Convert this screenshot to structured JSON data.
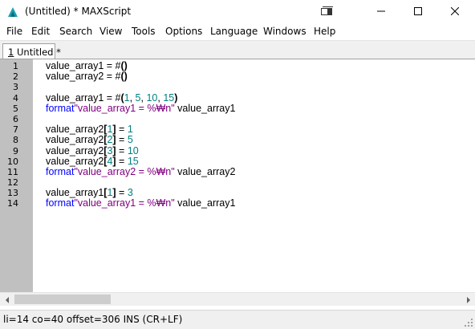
{
  "window": {
    "title": "(Untitled) * MAXScript"
  },
  "menu": {
    "items": [
      "File",
      "Edit",
      "Search",
      "View",
      "Tools",
      "Options",
      "Language",
      "Windows",
      "Help"
    ]
  },
  "tab": {
    "number": "1",
    "label": " Untitled *"
  },
  "editor": {
    "line_numbers": [
      "1",
      "2",
      "3",
      "4",
      "5",
      "6",
      "7",
      "8",
      "9",
      "10",
      "11",
      "12",
      "13",
      "14"
    ],
    "lines": [
      [
        {
          "t": "value_array1 = #",
          "c": "plain"
        },
        {
          "t": "()",
          "c": "plain-bold"
        }
      ],
      [
        {
          "t": "value_array2 = #",
          "c": "plain"
        },
        {
          "t": "()",
          "c": "plain-bold"
        }
      ],
      [],
      [
        {
          "t": "value_array1 = #",
          "c": "plain"
        },
        {
          "t": "(",
          "c": "plain-bold"
        },
        {
          "t": "1",
          "c": "num"
        },
        {
          "t": ", ",
          "c": "plain"
        },
        {
          "t": "5",
          "c": "num"
        },
        {
          "t": ", ",
          "c": "plain"
        },
        {
          "t": "10",
          "c": "num"
        },
        {
          "t": ", ",
          "c": "plain"
        },
        {
          "t": "15",
          "c": "num"
        },
        {
          "t": ")",
          "c": "plain-bold"
        }
      ],
      [
        {
          "t": "format",
          "c": "kw"
        },
        {
          "t": "\"value_array1 = %₩n\"",
          "c": "str"
        },
        {
          "t": " value_array1",
          "c": "plain"
        }
      ],
      [],
      [
        {
          "t": "value_array2",
          "c": "plain"
        },
        {
          "t": "[",
          "c": "plain-bold"
        },
        {
          "t": "1",
          "c": "num"
        },
        {
          "t": "]",
          "c": "plain-bold"
        },
        {
          "t": " = ",
          "c": "plain"
        },
        {
          "t": "1",
          "c": "num"
        }
      ],
      [
        {
          "t": "value_array2",
          "c": "plain"
        },
        {
          "t": "[",
          "c": "plain-bold"
        },
        {
          "t": "2",
          "c": "num"
        },
        {
          "t": "]",
          "c": "plain-bold"
        },
        {
          "t": " = ",
          "c": "plain"
        },
        {
          "t": "5",
          "c": "num"
        }
      ],
      [
        {
          "t": "value_array2",
          "c": "plain"
        },
        {
          "t": "[",
          "c": "plain-bold"
        },
        {
          "t": "3",
          "c": "num"
        },
        {
          "t": "]",
          "c": "plain-bold"
        },
        {
          "t": " = ",
          "c": "plain"
        },
        {
          "t": "10",
          "c": "num"
        }
      ],
      [
        {
          "t": "value_array2",
          "c": "plain"
        },
        {
          "t": "[",
          "c": "plain-bold"
        },
        {
          "t": "4",
          "c": "num"
        },
        {
          "t": "]",
          "c": "plain-bold"
        },
        {
          "t": " = ",
          "c": "plain"
        },
        {
          "t": "15",
          "c": "num"
        }
      ],
      [
        {
          "t": "format",
          "c": "kw"
        },
        {
          "t": "\"value_array2 = %₩n\"",
          "c": "str"
        },
        {
          "t": " value_array2",
          "c": "plain"
        }
      ],
      [],
      [
        {
          "t": "value_array1",
          "c": "plain"
        },
        {
          "t": "[",
          "c": "plain-bold"
        },
        {
          "t": "1",
          "c": "num"
        },
        {
          "t": "]",
          "c": "plain-bold"
        },
        {
          "t": " = ",
          "c": "plain"
        },
        {
          "t": "3",
          "c": "num"
        }
      ],
      [
        {
          "t": "format",
          "c": "kw"
        },
        {
          "t": "\"value_array1 = %₩n\"",
          "c": "str"
        },
        {
          "t": " value_array1",
          "c": "plain"
        }
      ]
    ]
  },
  "status": {
    "text": "li=14 co=40 offset=306 INS (CR+LF)"
  },
  "colors": {
    "gutter": "#c0c0c0",
    "number": "#008080",
    "keyword": "#0000ff",
    "string": "#800080"
  },
  "icons": [
    "maxscript-app-icon",
    "panel-toggle-icon",
    "minimize-icon",
    "maximize-icon",
    "close-icon",
    "scroll-left-icon",
    "scroll-right-icon",
    "resize-grip-icon"
  ]
}
